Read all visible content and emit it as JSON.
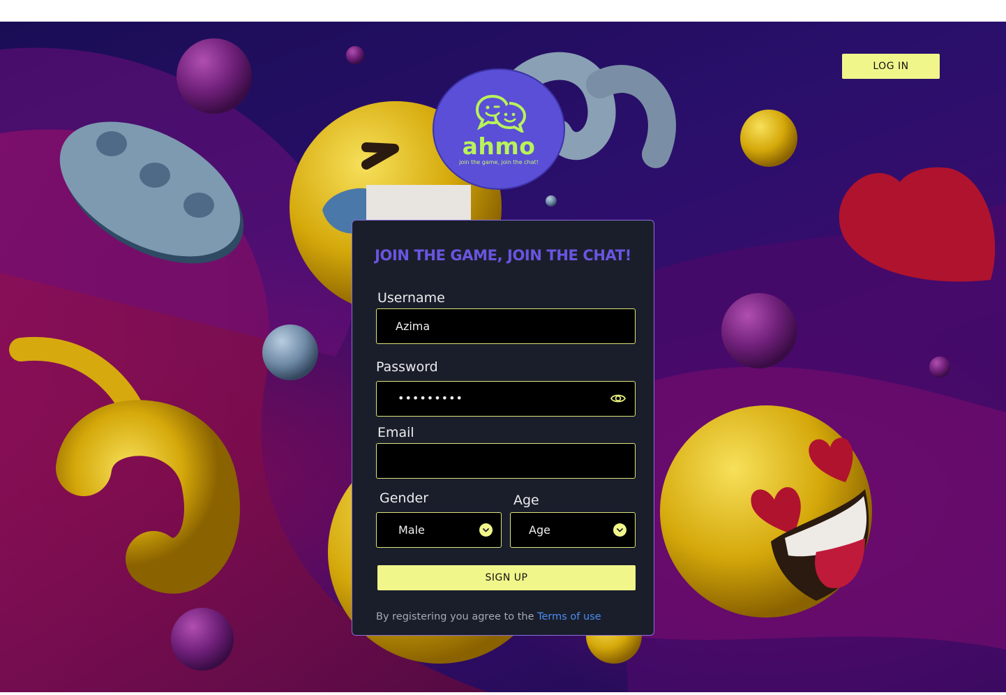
{
  "header": {
    "login_label": "LOG IN"
  },
  "logo": {
    "brand": "ahmo",
    "tagline": "join the game, join the chat!"
  },
  "form": {
    "title": "JOIN THE GAME, JOIN THE CHAT!",
    "username": {
      "label": "Username",
      "value": "Azima"
    },
    "password": {
      "label": "Password",
      "value": "•••••••••"
    },
    "email": {
      "label": "Email",
      "value": ""
    },
    "gender": {
      "label": "Gender",
      "selected": "Male"
    },
    "age": {
      "label": "Age",
      "selected": "Age"
    },
    "signup_label": "SIGN UP",
    "terms_prefix": "By registering you agree to the",
    "terms_link": "Terms of use"
  },
  "icons": {
    "logo": "chat-bubbles-icon",
    "password_toggle": "eye-icon",
    "select_arrow": "chevron-down-icon"
  },
  "colors": {
    "accent_yellow": "#f1f68b",
    "title_purple": "#6a55e0",
    "card_bg": "#1a1e2b",
    "link_blue": "#4c8ef0",
    "logo_circle": "#5a4fd6",
    "logo_text": "#b9f35a"
  }
}
